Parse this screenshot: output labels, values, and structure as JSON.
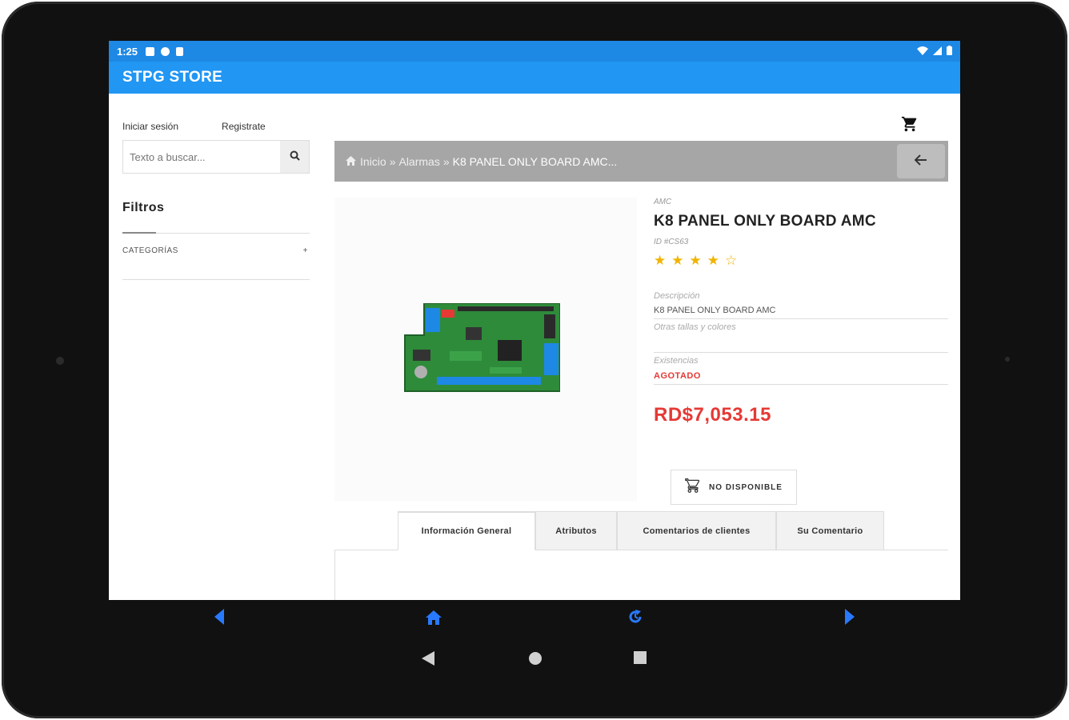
{
  "status_bar": {
    "time": "1:25"
  },
  "app_bar": {
    "title": "STPG STORE"
  },
  "sidebar": {
    "login": "Iniciar sesión",
    "register": "Registrate",
    "search_placeholder": "Texto a buscar...",
    "filters_title": "Filtros",
    "categories_label": "CATEGORÍAS",
    "categories_toggle": "+"
  },
  "breadcrumb": {
    "home": "Inicio",
    "separator": "»",
    "category": "Alarmas",
    "current": "K8 PANEL ONLY BOARD AMC..."
  },
  "product": {
    "brand": "AMC",
    "title": "K8 PANEL ONLY BOARD AMC",
    "id": "ID #CS63",
    "rating": 4,
    "rating_max": 5,
    "description_label": "Descripción",
    "description": "K8 PANEL ONLY BOARD AMC",
    "other_sizes": "Otras tallas y colores",
    "stock_label": "Existencias",
    "stock": "AGOTADO",
    "price": "RD$7,053.15",
    "unavailable_button": "NO DISPONIBLE"
  },
  "tabs": [
    {
      "label": "Información General",
      "active": true
    },
    {
      "label": "Atributos",
      "active": false
    },
    {
      "label": "Comentarios de clientes",
      "active": false
    },
    {
      "label": "Su Comentario",
      "active": false
    }
  ],
  "colors": {
    "status_bar": "#1e88e5",
    "app_bar": "#2196f3",
    "price": "#e53935",
    "star": "#f0b400",
    "nav_icon": "#2979ff"
  },
  "icons": {
    "search": "search-icon",
    "cart": "cart-icon",
    "back": "arrow-left-icon",
    "home": "home-icon",
    "reload": "reload-icon"
  }
}
